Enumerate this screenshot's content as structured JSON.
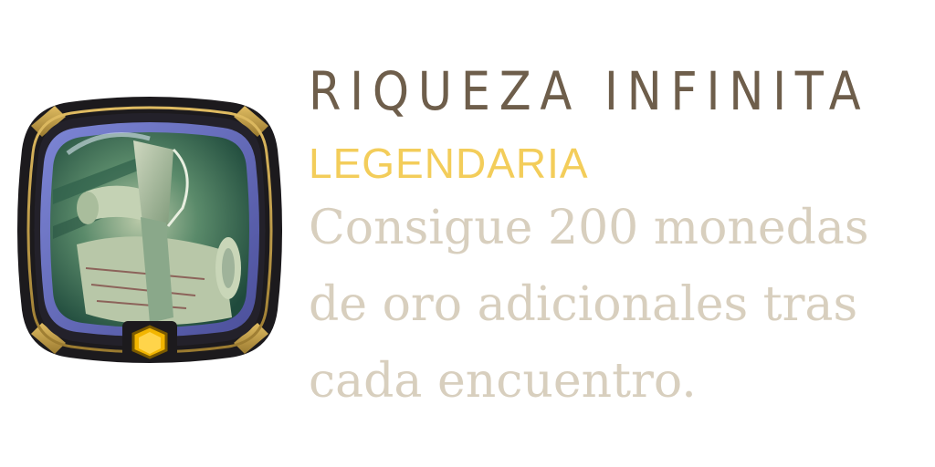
{
  "achievement": {
    "icon": "scroll-axe-icon",
    "gem_icon": "hexagon-gem-icon",
    "title": "RIQUEZA INFINITA",
    "rarity": "LEGENDARIA",
    "description_lines": [
      "Consigue 200 monedas",
      "de oro adicionales tras",
      "cada encuentro."
    ]
  },
  "colors": {
    "title": "#6e5e4b",
    "rarity": "#f3cd5a",
    "description": "#d8cfbe",
    "frame_gold": "#c9a24a",
    "gem": "#f2b500"
  }
}
